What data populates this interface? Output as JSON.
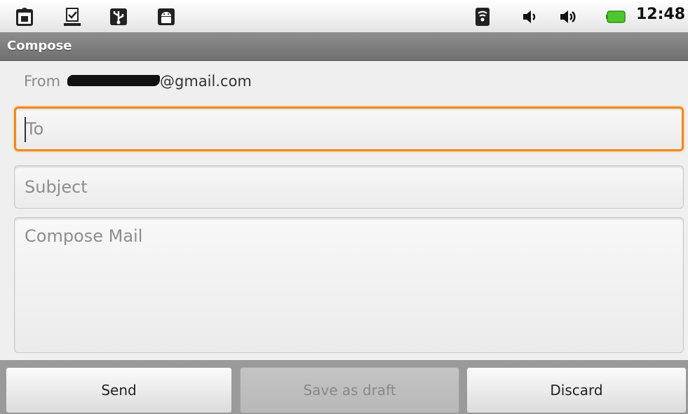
{
  "status_bar": {
    "time": "12:48",
    "left_icons": [
      "shopping-bag-icon",
      "download-done-icon",
      "usb-icon",
      "android-icon"
    ],
    "right_icons": [
      "wifi-icon",
      "volume-icon",
      "volume-icon",
      "battery-icon"
    ],
    "battery_color": "#4fc62a"
  },
  "titlebar": {
    "title": "Compose"
  },
  "compose": {
    "from_label": "From",
    "from_email_suffix": "@gmail.com",
    "to_placeholder": "To",
    "subject_placeholder": "Subject",
    "body_placeholder": "Compose Mail"
  },
  "buttons": {
    "send": "Send",
    "save_draft": "Save as draft",
    "discard": "Discard"
  },
  "colors": {
    "focus": "#f08a1c"
  }
}
